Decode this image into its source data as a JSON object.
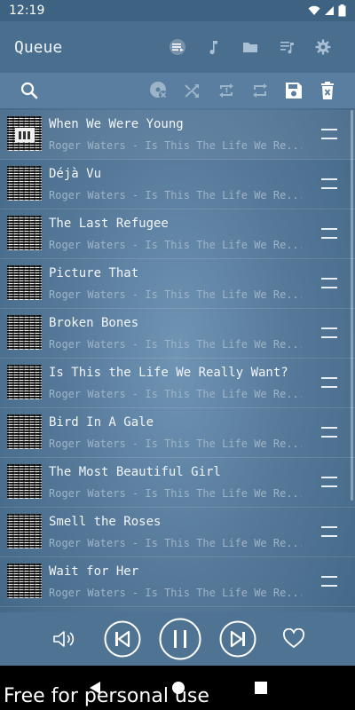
{
  "status_bar": {
    "time": "12:19"
  },
  "header": {
    "title": "Queue",
    "tabs": [
      {
        "name": "queue-icon"
      },
      {
        "name": "music-note-icon"
      },
      {
        "name": "folder-icon"
      },
      {
        "name": "playlist-icon"
      },
      {
        "name": "gear-icon"
      }
    ]
  },
  "toolbar": {
    "icons": [
      "search-icon",
      "clear-disc-icon",
      "shuffle-icon",
      "repeat-one-icon",
      "repeat-icon",
      "save-icon",
      "delete-icon"
    ]
  },
  "queue": [
    {
      "title": "When We Were Young",
      "subtitle": "Roger Waters - Is This The Life We Re..."
    },
    {
      "title": "Déjà Vu",
      "subtitle": "Roger Waters - Is This The Life We Re..."
    },
    {
      "title": "The Last Refugee",
      "subtitle": "Roger Waters - Is This The Life We Re..."
    },
    {
      "title": "Picture That",
      "subtitle": "Roger Waters - Is This The Life We Re..."
    },
    {
      "title": "Broken Bones",
      "subtitle": "Roger Waters - Is This The Life We Re..."
    },
    {
      "title": "Is This the Life We Really Want?",
      "subtitle": "Roger Waters - Is This The Life We Re..."
    },
    {
      "title": "Bird In A Gale",
      "subtitle": "Roger Waters - Is This The Life We Re..."
    },
    {
      "title": "The Most Beautiful Girl",
      "subtitle": "Roger Waters - Is This The Life We Re..."
    },
    {
      "title": "Smell the Roses",
      "subtitle": "Roger Waters - Is This The Life We Re..."
    },
    {
      "title": "Wait for Her",
      "subtitle": "Roger Waters - Is This The Life We Re..."
    }
  ],
  "controls": {
    "icons": [
      "volume-icon",
      "previous-icon",
      "pause-icon",
      "next-icon",
      "heart-icon"
    ]
  },
  "watermark": "Free for personal use",
  "colors": {
    "background": "#56799a",
    "title_bar": "#4a6e8e",
    "toolbar": "#5a7ea0",
    "text": "#f2f6fa",
    "subtext": "#9fb4c8"
  }
}
